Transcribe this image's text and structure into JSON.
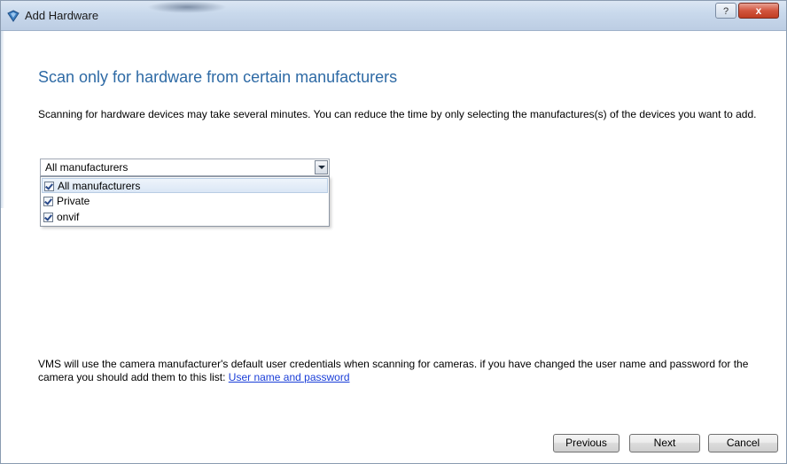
{
  "window": {
    "title": "Add Hardware",
    "help_label": "?",
    "close_label": "x"
  },
  "page": {
    "heading": "Scan only for hardware from certain manufacturers",
    "description": "Scanning for hardware devices may take several minutes. You can reduce the time by only selecting the manufactures(s) of the devices you want to add."
  },
  "manufacturer_select": {
    "value": "All manufacturers",
    "options": [
      {
        "label": "All manufacturers",
        "checked": true
      },
      {
        "label": "Private",
        "checked": true
      },
      {
        "label": "onvif",
        "checked": true
      }
    ]
  },
  "credentials_note": {
    "text": "VMS will use the camera manufacturer's default user credentials when scanning for cameras. if you have changed the user name and password for the camera you should add them to this list: ",
    "link_label": "User name and password"
  },
  "buttons": {
    "previous": "Previous",
    "next": "Next",
    "cancel": "Cancel"
  }
}
